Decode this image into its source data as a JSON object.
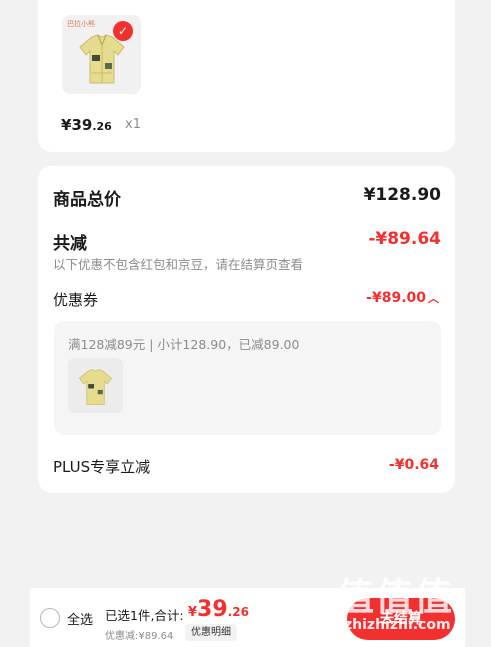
{
  "product": {
    "brand_mark": "巴拉小熊",
    "price_symbol": "¥",
    "price_int": "39",
    "price_cents": ".26",
    "quantity": "x1",
    "selected": true
  },
  "summary": {
    "goods_total_label": "商品总价",
    "goods_total_value": "¥128.90",
    "total_discount_label": "共减",
    "total_discount_value": "-¥89.64",
    "discount_note": "以下优惠不包含红包和京豆，请在结算页查看",
    "coupon_label": "优惠券",
    "coupon_value": "-¥89.00",
    "coupon_detail": "满128减89元 | 小计128.90，已减89.00",
    "plus_label": "PLUS专享立减",
    "plus_value": "-¥0.64"
  },
  "bottom_bar": {
    "select_all_label": "全选",
    "selected_count_label": "已选1件,合计:",
    "total_symbol": "¥",
    "total_int": "39",
    "total_cents": ".26",
    "discount_label": "优惠减:¥89.64",
    "detail_button": "优惠明细",
    "checkout_button": "去结算"
  },
  "watermark": {
    "text": "值值值",
    "url": "zhizhizhi.com"
  },
  "colors": {
    "accent": "#f2302f",
    "background": "#f2f2f2",
    "card": "#ffffff",
    "muted_text": "#8c8c8c"
  }
}
